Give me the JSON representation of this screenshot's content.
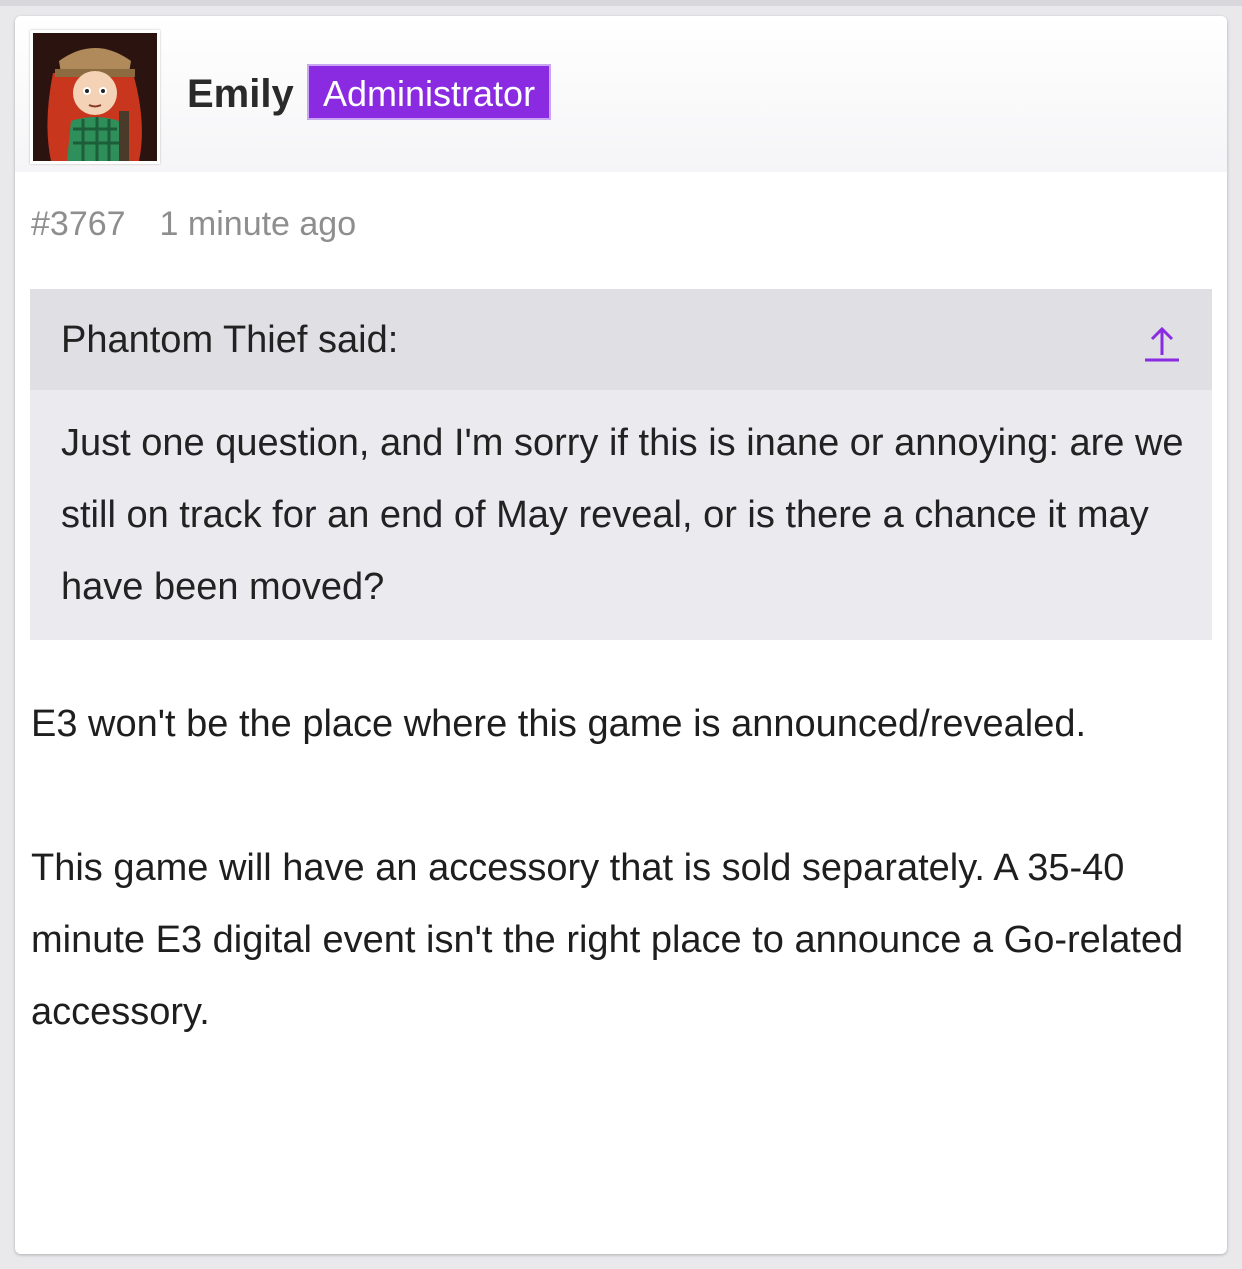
{
  "post": {
    "author": {
      "name": "Emily",
      "role": "Administrator",
      "avatar_icon": "avatar-image"
    },
    "number": "#3767",
    "time": "1 minute ago",
    "quote": {
      "author_line": "Phantom Thief said:",
      "jump_icon": "arrow-up-icon",
      "text": "Just one question, and I'm sorry if this is inane or annoying: are we still on track for an end of May reveal, or is there a chance it may have been moved?"
    },
    "paragraphs": [
      "E3 won't be the place where this game is announced/revealed.",
      "This game will have an accessory that is sold separately. A 35-40 minute E3 digital event isn't the right place to announce a Go-related accessory."
    ]
  },
  "colors": {
    "accent": "#8a2be2",
    "quote_background": "#ebebef",
    "quote_header": "#dfdfe4",
    "meta_text": "#8e8e8e"
  }
}
